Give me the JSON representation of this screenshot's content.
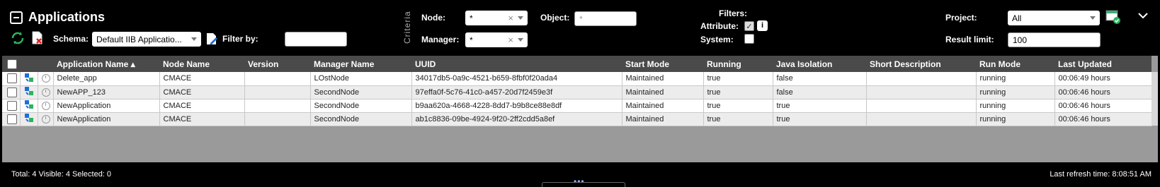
{
  "header": {
    "title": "Applications",
    "schema_label": "Schema:",
    "schema_value": "Default IIB Applicatio...",
    "filter_by_label": "Filter by:",
    "filter_by_value": "",
    "criteria_label": "Criteria",
    "node_label": "Node:",
    "node_value": "*",
    "manager_label": "Manager:",
    "manager_value": "*",
    "object_label": "Object:",
    "object_placeholder": "*",
    "filters_label": "Filters:",
    "attribute_label": "Attribute:",
    "attribute_checked": true,
    "system_label": "System:",
    "system_checked": false,
    "project_label": "Project:",
    "project_value": "All",
    "result_limit_label": "Result limit:",
    "result_limit_value": "100"
  },
  "table": {
    "columns": [
      "Application Name",
      "Node Name",
      "Version",
      "Manager Name",
      "UUID",
      "Start Mode",
      "Running",
      "Java Isolation",
      "Short Description",
      "Run Mode",
      "Last Updated"
    ],
    "sort_indicator": "▴",
    "rows": [
      [
        "Delete_app",
        "CMACE",
        "",
        "LOstNode",
        "34017db5-0a9c-4521-b659-8fbf0f20ada4",
        "Maintained",
        "true",
        "false",
        "",
        "running",
        "00:06:49 hours"
      ],
      [
        "NewAPP_123",
        "CMACE",
        "",
        "SecondNode",
        "97effa0f-5c76-41c0-a457-20d7f2459e3f",
        "Maintained",
        "true",
        "false",
        "",
        "running",
        "00:06:46 hours"
      ],
      [
        "NewApplication",
        "CMACE",
        "",
        "SecondNode",
        "b9aa620a-4668-4228-8dd7-b9b8ce88e8df",
        "Maintained",
        "true",
        "true",
        "",
        "running",
        "00:06:46 hours"
      ],
      [
        "NewApplication",
        "CMACE",
        "",
        "SecondNode",
        "ab1c8836-09be-4924-9f20-2ff2cdd5a8ef",
        "Maintained",
        "true",
        "true",
        "",
        "running",
        "00:06:46 hours"
      ]
    ]
  },
  "footer": {
    "summary": "Total: 4 Visible: 4 Selected: 0",
    "last_refresh": "Last refresh time: 8:08:51 AM",
    "dots": "•••"
  },
  "colors": {
    "background": "#000000",
    "header_row": "#4a4a4a",
    "empty_area": "#9a9a9a",
    "accent_green": "#2db35d",
    "accent_blue": "#1e6fd9"
  }
}
